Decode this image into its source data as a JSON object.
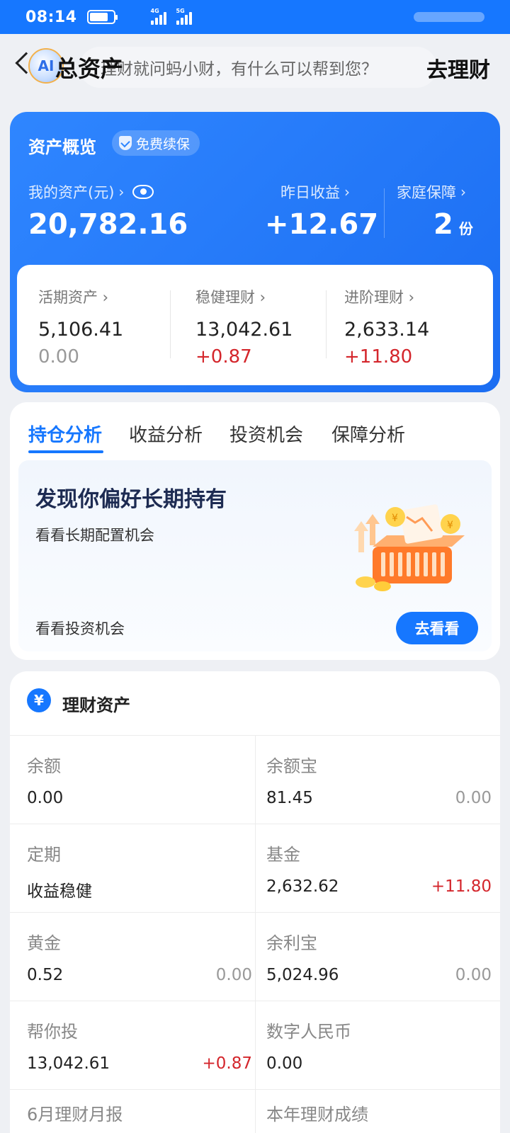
{
  "status_bar": {
    "time": "08:14",
    "network_1": "4G",
    "network_2": "5G",
    "battery_level_percent": 80
  },
  "header": {
    "back_icon": "chevron-left-icon",
    "logo_text": "AI",
    "search_placeholder": "理财就问蚂小财，有什么可以帮到您？",
    "title": "总资产",
    "action": "去理财"
  },
  "overview": {
    "title": "资产概览",
    "badge": "免费续保",
    "my_assets_label": "我的资产(元)",
    "my_assets_value": "20,782.16",
    "yesterday_label": "昨日收益",
    "yesterday_value": "+12.67",
    "family_label": "家庭保障",
    "family_value": "2",
    "family_unit": "份",
    "breakdown": [
      {
        "label": "活期资产",
        "value": "5,106.41",
        "change": "0.00"
      },
      {
        "label": "稳健理财",
        "value": "13,042.61",
        "change": "+0.87"
      },
      {
        "label": "进阶理财",
        "value": "2,633.14",
        "change": "+11.80"
      }
    ]
  },
  "analysis": {
    "tabs": [
      "持仓分析",
      "收益分析",
      "投资机会",
      "保障分析"
    ],
    "promo_title": "发现你偏好长期持有",
    "promo_subtitle": "看看长期配置机会",
    "promo_link": "看看投资机会",
    "promo_button": "去看看"
  },
  "assets": {
    "title": "理财资产",
    "cells": [
      {
        "label": "余额",
        "value": "0.00",
        "change": ""
      },
      {
        "label": "余额宝",
        "value": "81.45",
        "change": "0.00"
      },
      {
        "label": "定期",
        "value": "收益稳健",
        "change": ""
      },
      {
        "label": "基金",
        "value": "2,632.62",
        "change": "+11.80"
      },
      {
        "label": "黄金",
        "value": "0.52",
        "change": "0.00"
      },
      {
        "label": "余利宝",
        "value": "5,024.96",
        "change": "0.00"
      },
      {
        "label": "帮你投",
        "value": "13,042.61",
        "change": "+0.87"
      },
      {
        "label": "数字人民币",
        "value": "0.00",
        "change": ""
      },
      {
        "label": "6月理财月报",
        "value": "",
        "change": ""
      },
      {
        "label": "本年理财成绩",
        "value": "",
        "change": ""
      }
    ]
  },
  "colors": {
    "accent": "#1677ff",
    "positive": "#d4262c",
    "neutral": "#999999"
  }
}
